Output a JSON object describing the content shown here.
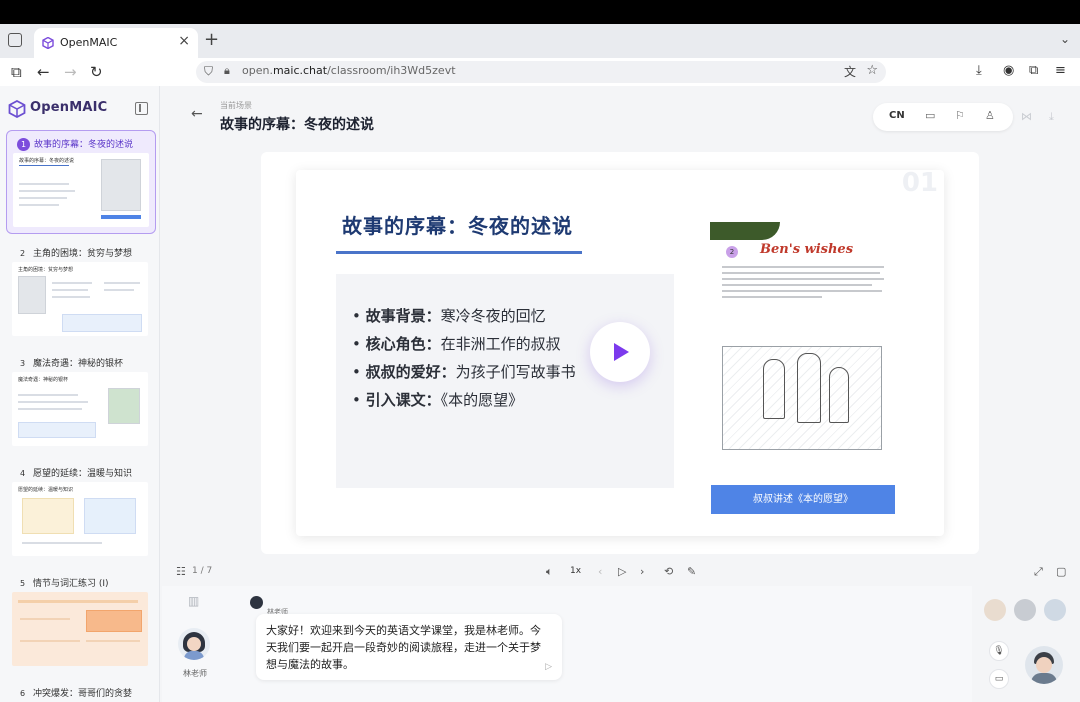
{
  "browser": {
    "tab_title": "OpenMAIC",
    "tab_close": "×",
    "new_tab": "+",
    "url_domain_prefix": "open.",
    "url_domain": "maic.chat",
    "url_path": "/classroom/ih3Wd5zevt"
  },
  "sidebar": {
    "brand": "OpenMAIC",
    "items": [
      {
        "num": "1",
        "label": "故事的序幕：冬夜的述说",
        "thumb_title": "故事的序幕：冬夜的述说"
      },
      {
        "num": "2",
        "label": "主角的困境：贫穷与梦想",
        "thumb_title": "主角的困境：贫穷与梦想"
      },
      {
        "num": "3",
        "label": "魔法奇遇：神秘的银杯",
        "thumb_title": "魔法奇遇：神秘的银杯"
      },
      {
        "num": "4",
        "label": "愿望的延续：温暖与知识",
        "thumb_title": "愿望的延续：温暖与知识"
      },
      {
        "num": "5",
        "label": "情节与词汇练习 (I)",
        "thumb_title": ""
      },
      {
        "num": "6",
        "label": "冲突爆发：哥哥们的贪婪",
        "thumb_title": ""
      }
    ]
  },
  "header": {
    "crumb": "当前场景",
    "title": "故事的序幕：冬夜的述说",
    "lang": "CN"
  },
  "slide": {
    "page_number": "01",
    "title": "故事的序幕：冬夜的述说",
    "bullets": [
      {
        "key": "故事背景：",
        "value": "寒冷冬夜的回忆"
      },
      {
        "key": "核心角色：",
        "value": "在非洲工作的叔叔"
      },
      {
        "key": "叔叔的爱好：",
        "value": "为孩子们写故事书"
      },
      {
        "key": "引入课文：",
        "value": "《本的愿望》"
      }
    ],
    "book_badge": "2",
    "book_title": "Ben's wishes",
    "book_button": "叔叔讲述《本的愿望》"
  },
  "playback": {
    "page": "1 / 7",
    "speed": "1x"
  },
  "chat": {
    "teacher_name": "林老师",
    "speaker_name": "林老师",
    "message": "大家好！欢迎来到今天的英语文学课堂，我是林老师。今天我们要一起开启一段奇妙的阅读旅程，走进一个关于梦想与魔法的故事。"
  },
  "colors": {
    "accent": "#7c4ddc",
    "slide_title": "#1e3a72",
    "book_button": "#4f84e6"
  }
}
